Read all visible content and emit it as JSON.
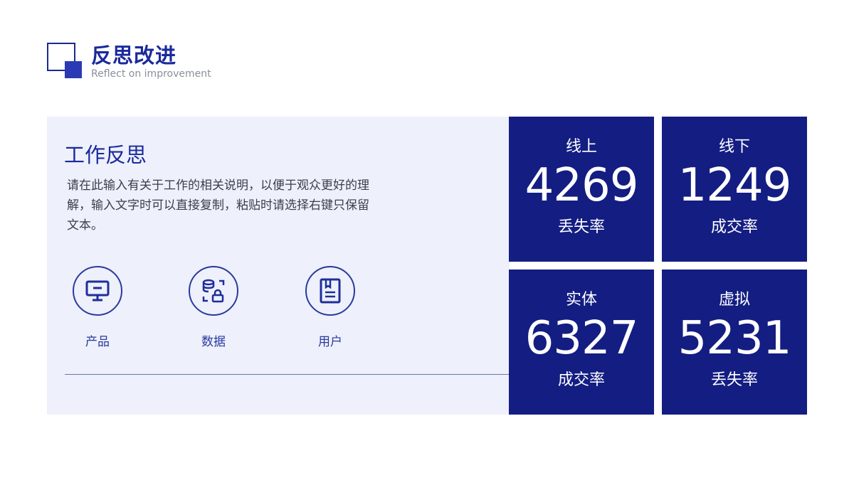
{
  "header": {
    "title": "反思改进",
    "subtitle": "Reflect on improvement"
  },
  "panel": {
    "title": "工作反思",
    "body_lines": [
      "请在此输入有关于工作的相关说明，以便于观众更好的理",
      "解，输入文字时可以直接复制，粘贴时请选择右键只保留",
      "文本。"
    ],
    "features": [
      {
        "label": "产品",
        "icon": "monitor-icon"
      },
      {
        "label": "数据",
        "icon": "database-lock-icon"
      },
      {
        "label": "用户",
        "icon": "document-icon"
      }
    ]
  },
  "stats": [
    {
      "top": "线上",
      "value": "4269",
      "bottom": "丢失率"
    },
    {
      "top": "线下",
      "value": "1249",
      "bottom": "成交率"
    },
    {
      "top": "实体",
      "value": "6327",
      "bottom": "成交率"
    },
    {
      "top": "虚拟",
      "value": "5231",
      "bottom": "丢失率"
    }
  ],
  "colors": {
    "accent": "#1a2a9c",
    "tile": "#131d82",
    "panel_bg": "#eef0fb"
  }
}
